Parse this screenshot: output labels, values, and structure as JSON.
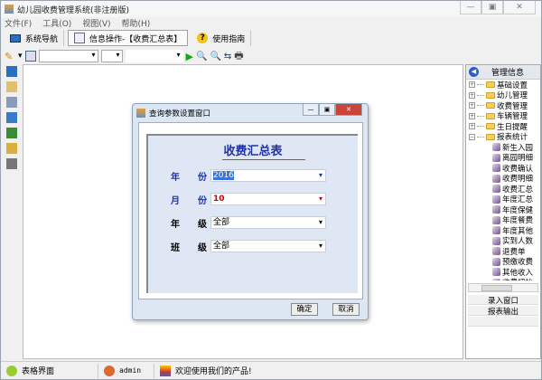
{
  "app": {
    "title": "幼儿园收费管理系统(非注册版)"
  },
  "window_controls": {
    "minimize": "—",
    "maximize": "▣",
    "close": "✕"
  },
  "menu": [
    "文件(F)",
    "工具(O)",
    "视图(V)",
    "帮助(H)"
  ],
  "tabs": [
    {
      "label": "系统导航"
    },
    {
      "label": "信息操作-【收费汇总表】"
    },
    {
      "label": "使用指南"
    }
  ],
  "right_panel": {
    "title": "管理信息",
    "folders": [
      {
        "label": "基础设置",
        "expanded": false
      },
      {
        "label": "幼儿管理",
        "expanded": false
      },
      {
        "label": "收费管理",
        "expanded": false
      },
      {
        "label": "车辆管理",
        "expanded": false
      },
      {
        "label": "生日提醒",
        "expanded": false
      },
      {
        "label": "报表统计",
        "expanded": true
      }
    ],
    "leaves": [
      "新生入园",
      "离园明细",
      "收费确认",
      "收费明细",
      "收费汇总",
      "年度汇总",
      "年度保健",
      "年度餐费",
      "年度其他",
      "实到人数",
      "退费单",
      "预缴收费",
      "其他收入",
      "收费初始"
    ],
    "buttons": [
      "录入窗口",
      "报表输出"
    ]
  },
  "dialog": {
    "title": "查询参数设置窗口",
    "heading": "收费汇总表",
    "fields": [
      {
        "label1": "年",
        "label2": "份",
        "value": "2016"
      },
      {
        "label1": "月",
        "label2": "份",
        "value": "10"
      },
      {
        "label1": "年",
        "label2": "级",
        "value": "全部"
      },
      {
        "label1": "班",
        "label2": "级",
        "value": "全部"
      }
    ],
    "ok": "确定",
    "cancel": "取消"
  },
  "status": {
    "mode": "表格界面",
    "user": "admin",
    "message": "欢迎使用我们的产品!"
  },
  "colors": {
    "accent": "#2233aa",
    "month_value": "#cc0000"
  }
}
